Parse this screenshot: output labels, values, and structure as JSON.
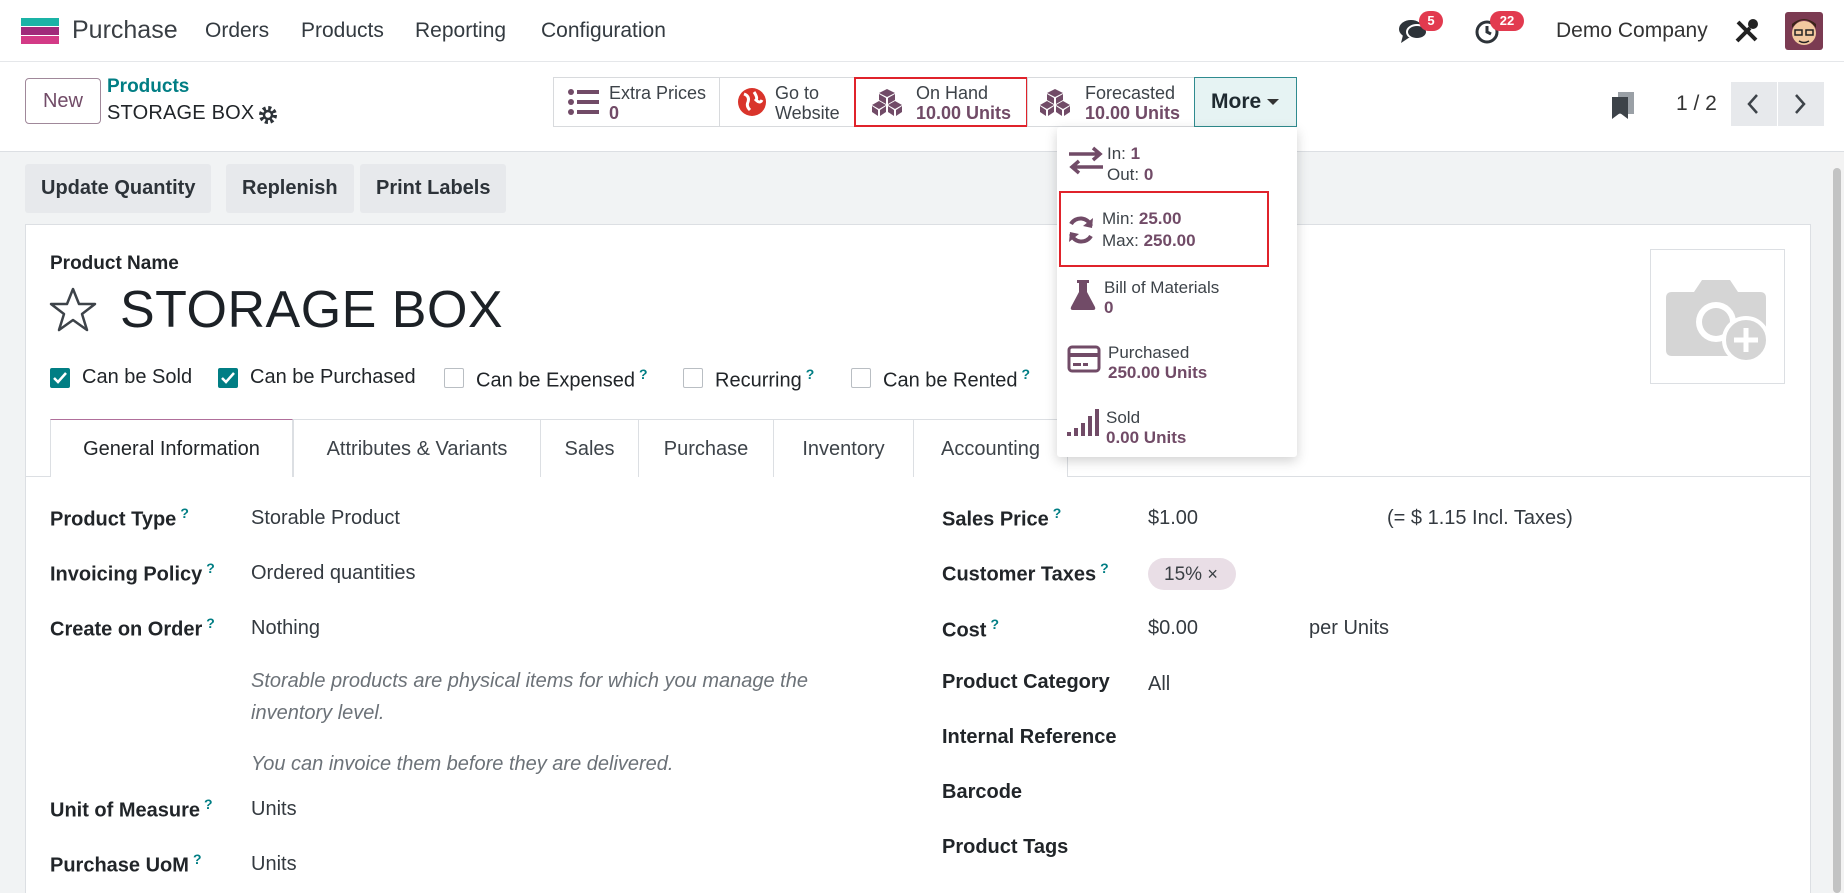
{
  "app": {
    "name": "Purchase"
  },
  "nav": [
    "Orders",
    "Products",
    "Reporting",
    "Configuration"
  ],
  "systray": {
    "messages_count": "5",
    "activities_count": "22",
    "company": "Demo Company"
  },
  "control_panel": {
    "new_label": "New",
    "breadcrumb_parent": "Products",
    "breadcrumb_current": "STORAGE BOX",
    "pager": "1 / 2"
  },
  "smart_buttons": {
    "extra_prices": {
      "label": "Extra Prices",
      "value": "0"
    },
    "website": {
      "label1": "Go to",
      "label2": "Website"
    },
    "on_hand": {
      "label": "On Hand",
      "value": "10.00 Units"
    },
    "forecasted": {
      "label": "Forecasted",
      "value": "10.00 Units"
    },
    "more": "More"
  },
  "more_menu": {
    "in_label": "In:",
    "in_value": "1",
    "out_label": "Out:",
    "out_value": "0",
    "min_label": "Min:",
    "min_value": "25.00",
    "max_label": "Max:",
    "max_value": "250.00",
    "bom_label": "Bill of Materials",
    "bom_value": "0",
    "purchased_label": "Purchased",
    "purchased_value": "250.00 Units",
    "sold_label": "Sold",
    "sold_value": "0.00 Units"
  },
  "actions": [
    "Update Quantity",
    "Replenish",
    "Print Labels"
  ],
  "product": {
    "name_label": "Product Name",
    "name": "STORAGE BOX",
    "checkboxes": [
      {
        "label": "Can be Sold",
        "checked": true,
        "help": ""
      },
      {
        "label": "Can be Purchased",
        "checked": true,
        "help": ""
      },
      {
        "label": "Can be Expensed",
        "checked": false,
        "help": "?"
      },
      {
        "label": "Recurring",
        "checked": false,
        "help": "?"
      },
      {
        "label": "Can be Rented",
        "checked": false,
        "help": "?"
      }
    ]
  },
  "tabs": [
    "General Information",
    "Attributes & Variants",
    "Sales",
    "Purchase",
    "Inventory",
    "Accounting"
  ],
  "left_fields": {
    "product_type_label": "Product Type",
    "product_type": "Storable Product",
    "invoicing_label": "Invoicing Policy",
    "invoicing": "Ordered quantities",
    "create_label": "Create on Order",
    "create": "Nothing",
    "hint1": "Storable products are physical items for which you manage the inventory level.",
    "hint2": "You can invoice them before they are delivered.",
    "uom_label": "Unit of Measure",
    "uom": "Units",
    "puom_label": "Purchase UoM",
    "puom": "Units"
  },
  "right_fields": {
    "sales_price_label": "Sales Price",
    "sales_price": "$1.00",
    "incl_taxes": "(= $ 1.15 Incl. Taxes)",
    "taxes_label": "Customer Taxes",
    "tax_tag": "15%",
    "cost_label": "Cost",
    "cost": "$0.00",
    "cost_unit": "per Units",
    "category_label": "Product Category",
    "category": "All",
    "internal_ref_label": "Internal Reference",
    "barcode_label": "Barcode",
    "tags_label": "Product Tags"
  },
  "colors": {
    "brand": "#714b67",
    "accent": "#017e84",
    "highlight": "#e0232b"
  }
}
